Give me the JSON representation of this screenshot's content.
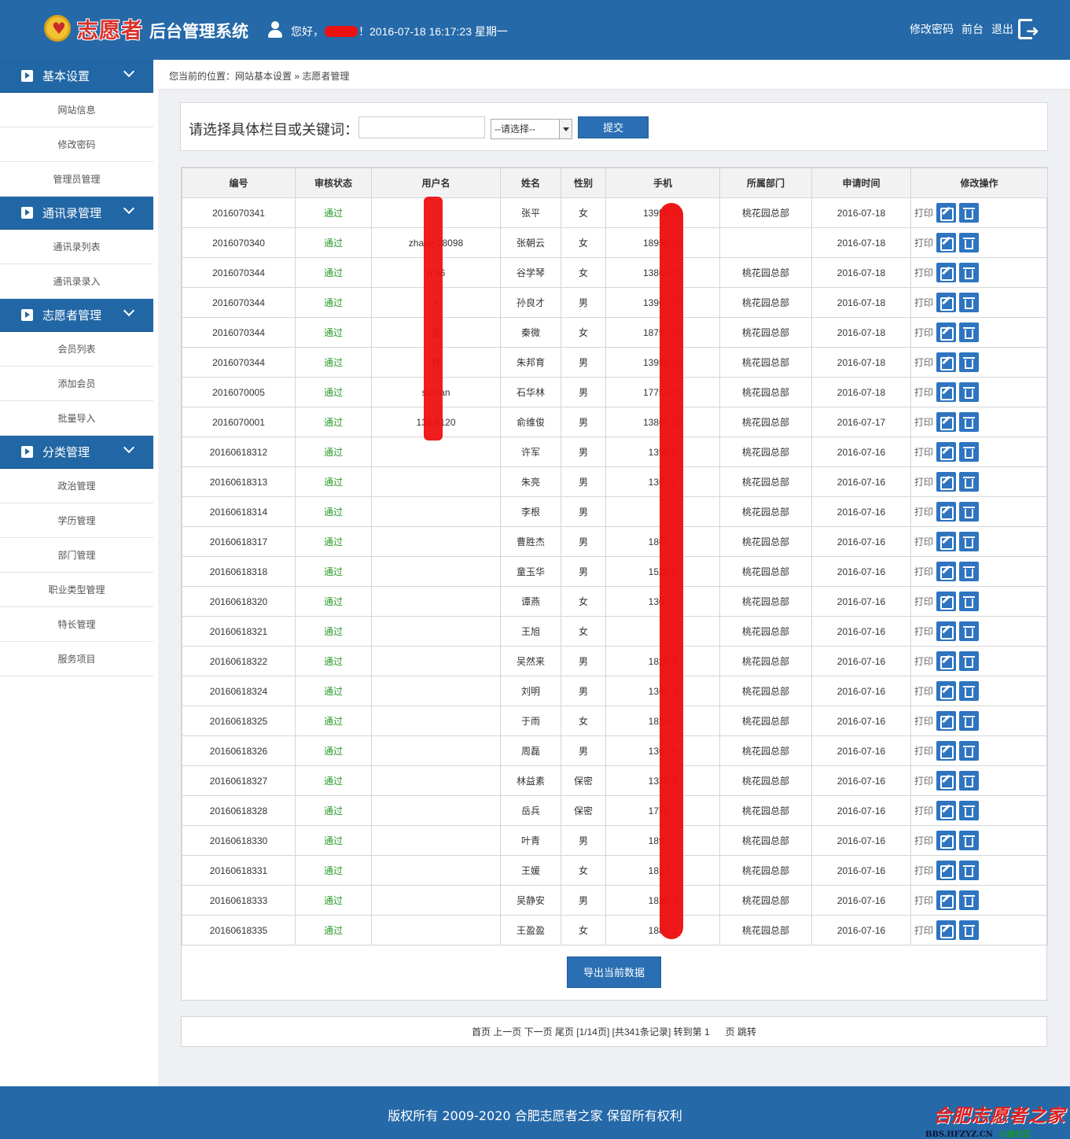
{
  "header": {
    "logo_text": "志愿者",
    "system_title": "后台管理系统",
    "greeting_prefix": "您好，",
    "greeting_suffix": "！2016-07-18 16:17:23 星期一",
    "links": [
      "修改密码",
      "前台",
      "退出"
    ]
  },
  "sidebar": {
    "groups": [
      {
        "label": "基本设置",
        "items": [
          "网站信息",
          "修改密码",
          "管理员管理"
        ]
      },
      {
        "label": "通讯录管理",
        "items": [
          "通讯录列表",
          "通讯录录入"
        ]
      },
      {
        "label": "志愿者管理",
        "items": [
          "会员列表",
          "添加会员",
          "批量导入"
        ]
      },
      {
        "label": "分类管理",
        "items": [
          "政治管理",
          "学历管理",
          "部门管理",
          "职业类型管理",
          "特长管理",
          "服务项目"
        ]
      }
    ]
  },
  "breadcrumb": "您当前的位置：网站基本设置 » 志愿者管理",
  "search": {
    "label": "请选择具体栏目或关键词：",
    "input_value": "",
    "select_value": "--请选择--",
    "submit_label": "提交"
  },
  "table": {
    "headers": [
      "编号",
      "审核状态",
      "用户名",
      "姓名",
      "性别",
      "手机",
      "所属部门",
      "申请时间",
      "修改操作"
    ],
    "print_label": "打印",
    "rows": [
      [
        "2016070341",
        "通过",
        "",
        "张平",
        "女",
        "13956    55",
        "桃花园总部",
        "2016-07-18"
      ],
      [
        "2016070340",
        "通过",
        "zhang    28098",
        "张朝云",
        "女",
        "18956    45",
        "",
        "2016-07-18"
      ],
      [
        "2016070344",
        "通过",
        "h    46",
        "谷学琴",
        "女",
        "13866    71",
        "桃花园总部",
        "2016-07-18"
      ],
      [
        "2016070344",
        "通过",
        "    e",
        "孙良才",
        "男",
        "13966    76",
        "桃花园总部",
        "2016-07-18"
      ],
      [
        "2016070344",
        "通过",
        "    雷",
        "秦微",
        "女",
        "18797    05",
        "桃花园总部",
        "2016-07-18"
      ],
      [
        "2016070344",
        "通过",
        "    育",
        "朱邦育",
        "男",
        "13956    02",
        "桃花园总部",
        "2016-07-18"
      ],
      [
        "2016070005",
        "通过",
        "su    nan",
        "石华林",
        "男",
        "17756    21",
        "桃花园总部",
        "2016-07-18"
      ],
      [
        "2016070001",
        "通过",
        "138    8120",
        "俞维俊",
        "男",
        "13866    20",
        "桃花园总部",
        "2016-07-17"
      ],
      [
        "20160618312",
        "通过",
        "",
        "许军",
        "男",
        "1395    0",
        "桃花园总部",
        "2016-07-16"
      ],
      [
        "20160618313",
        "通过",
        "",
        "朱亮",
        "男",
        "1369    5",
        "桃花园总部",
        "2016-07-16"
      ],
      [
        "20160618314",
        "通过",
        "",
        "李根",
        "男",
        "",
        "桃花园总部",
        "2016-07-16"
      ],
      [
        "20160618317",
        "通过",
        "",
        "曹胜杰",
        "男",
        "1865    3",
        "桃花园总部",
        "2016-07-16"
      ],
      [
        "20160618318",
        "通过",
        "",
        "童玉华",
        "男",
        "1525    9",
        "桃花园总部",
        "2016-07-16"
      ],
      [
        "20160618320",
        "通过",
        "",
        "谭燕",
        "女",
        "1301    3",
        "桃花园总部",
        "2016-07-16"
      ],
      [
        "20160618321",
        "通过",
        "",
        "王旭",
        "女",
        "",
        "桃花园总部",
        "2016-07-16"
      ],
      [
        "20160618322",
        "通过",
        "",
        "吴然来",
        "男",
        "1820    4",
        "桃花园总部",
        "2016-07-16"
      ],
      [
        "20160618324",
        "通过",
        "",
        "刘明",
        "男",
        "1362    3",
        "桃花园总部",
        "2016-07-16"
      ],
      [
        "20160618325",
        "通过",
        "",
        "于雨",
        "女",
        "1829    5",
        "桃花园总部",
        "2016-07-16"
      ],
      [
        "20160618326",
        "通过",
        "",
        "周磊",
        "男",
        "1367    9",
        "桃花园总部",
        "2016-07-16"
      ],
      [
        "20160618327",
        "通过",
        "",
        "林益素",
        "保密",
        "1335    4",
        "桃花园总部",
        "2016-07-16"
      ],
      [
        "20160618328",
        "通过",
        "",
        "岳兵",
        "保密",
        "1775    1",
        "桃花园总部",
        "2016-07-16"
      ],
      [
        "20160618330",
        "通过",
        "",
        "叶青",
        "男",
        "1895    0",
        "桃花园总部",
        "2016-07-16"
      ],
      [
        "20160618331",
        "通过",
        "",
        "王媛",
        "女",
        "1813    7",
        "桃花园总部",
        "2016-07-16"
      ],
      [
        "20160618333",
        "通过",
        "",
        "吴静安",
        "男",
        "1822    3",
        "桃花园总部",
        "2016-07-16"
      ],
      [
        "20160618335",
        "通过",
        "",
        "王盈盈",
        "女",
        "1885    2",
        "桃花园总部",
        "2016-07-16"
      ]
    ]
  },
  "export_label": "导出当前数据",
  "pager": {
    "text": "首页 上一页 下一页 尾页 [1/14页] [共341条记录] 转到第 1      页 跳转"
  },
  "footer": {
    "copyright": "版权所有 2009-2020 合肥志愿者之家 保留所有权利",
    "watermark_main": "合肥志愿者之家",
    "watermark_url": "BBS.HFZYZ.CN",
    "watermark_tag": "公益社区"
  },
  "colors": {
    "primary": "#2569a8",
    "status_pass": "#2a9a2a",
    "op_button": "#2e74c0"
  }
}
